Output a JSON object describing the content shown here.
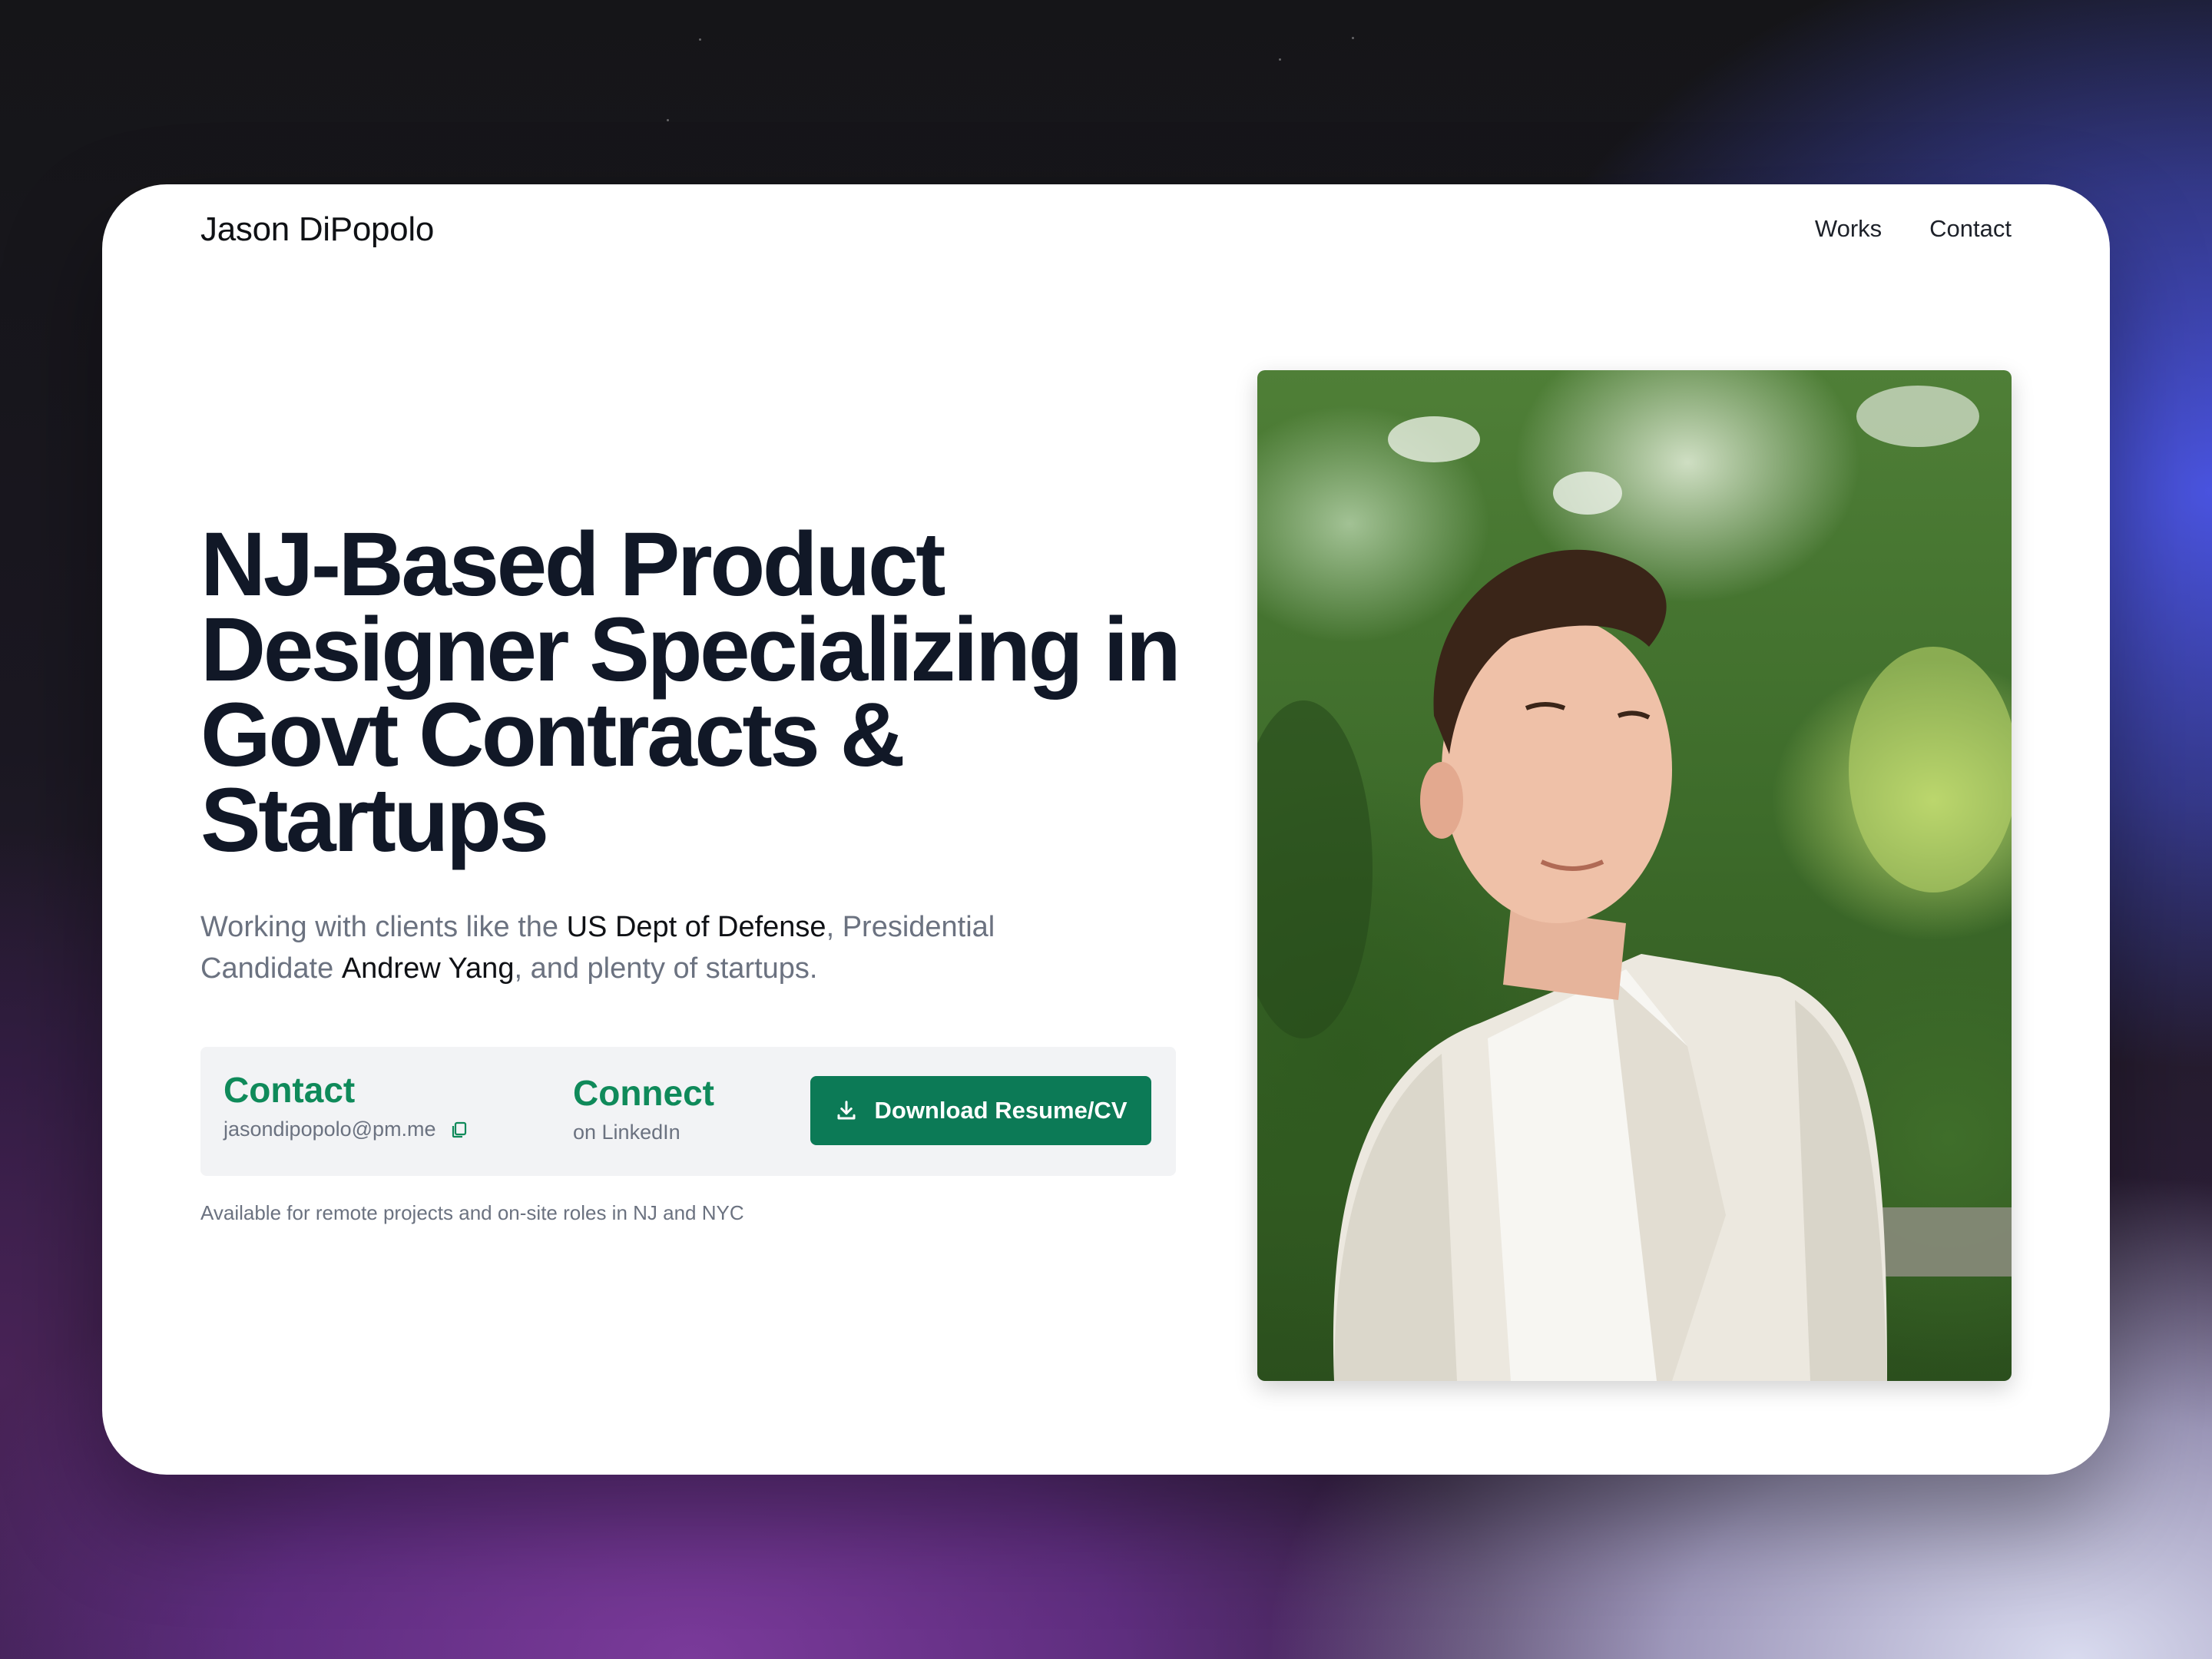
{
  "nav": {
    "brand": "Jason DiPopolo",
    "links": [
      "Works",
      "Contact"
    ]
  },
  "hero": {
    "title": "NJ-Based Product Designer Specializing in Govt Contracts & Startups",
    "subtitle": {
      "part1": "Working with clients like the ",
      "client1": "US Dept of Defense",
      "part2": ", Presidential Candidate ",
      "client2": "Andrew Yang",
      "part3": ", and plenty of startups."
    }
  },
  "cta": {
    "contact_heading": "Contact",
    "email": "jasondipopolo@pm.me",
    "connect_heading": "Connect",
    "connect_sub": "on LinkedIn",
    "download_label": "Download Resume/CV"
  },
  "availability": "Available for remote projects and on-site roles in NJ and NYC",
  "icons": {
    "copy": "copy-icon",
    "download": "download-icon"
  },
  "colors": {
    "accent": "#0c7a56",
    "accent_text": "#0f8a5a",
    "heading": "#111827",
    "muted": "#6b7280"
  }
}
